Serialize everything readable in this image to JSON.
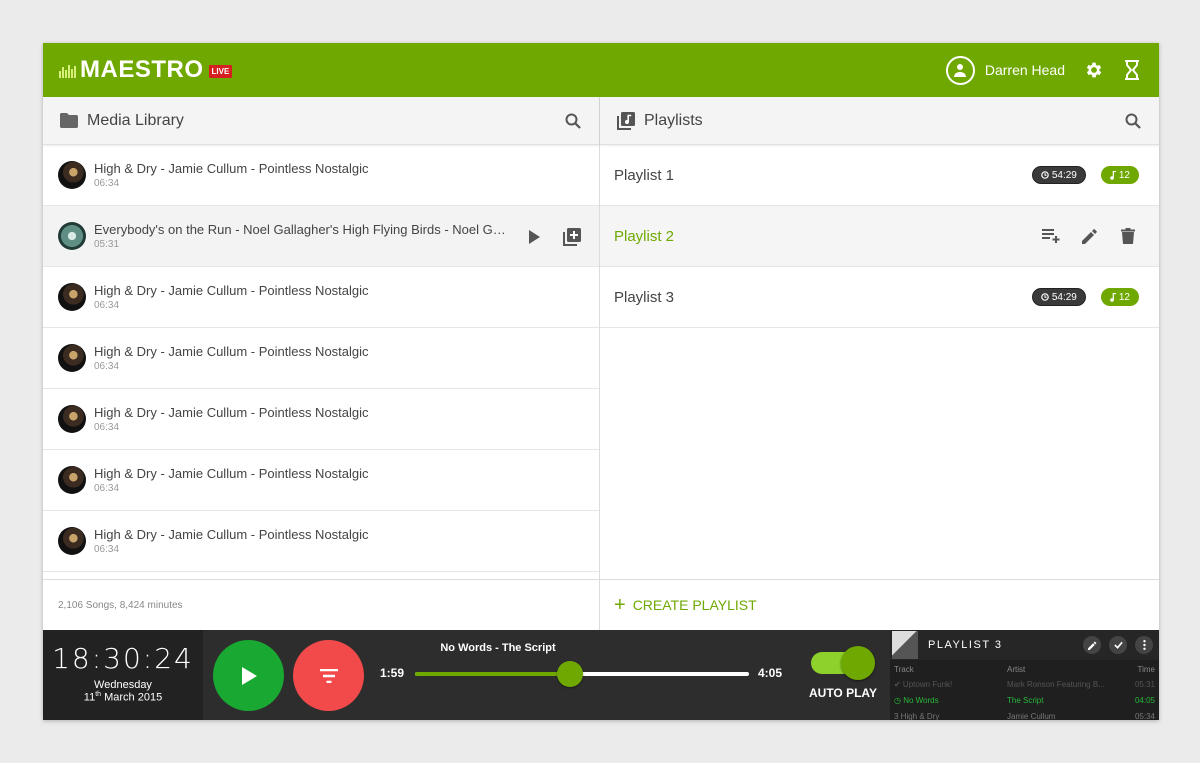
{
  "header": {
    "logo_text": "MAESTRO",
    "live_badge": "LIVE",
    "user_name": "Darren Head",
    "colors": {
      "brand_green": "#6fa800",
      "live_red": "#d61f1f"
    },
    "icons": [
      "account-circle-icon",
      "gear-icon",
      "hourglass-icon"
    ]
  },
  "library": {
    "title": "Media Library",
    "items": [
      {
        "title": "High & Dry - Jamie Cullum - Pointless Nostalgic",
        "duration": "06:34"
      },
      {
        "title": "Everybody's on the Run - Noel Gallagher's High Flying Birds - Noel Gallagher's High Flying Birds",
        "duration": "05:31"
      },
      {
        "title": "High & Dry - Jamie Cullum - Pointless Nostalgic",
        "duration": "06:34"
      },
      {
        "title": "High & Dry - Jamie Cullum - Pointless Nostalgic",
        "duration": "06:34"
      },
      {
        "title": "High & Dry - Jamie Cullum - Pointless Nostalgic",
        "duration": "06:34"
      },
      {
        "title": "High & Dry - Jamie Cullum - Pointless Nostalgic",
        "duration": "06:34"
      },
      {
        "title": "High & Dry - Jamie Cullum - Pointless Nostalgic",
        "duration": "06:34"
      }
    ],
    "footer": "2,106 Songs, 8,424 minutes"
  },
  "playlists": {
    "title": "Playlists",
    "items": [
      {
        "name": "Playlist 1",
        "time": "54:29",
        "count": "12"
      },
      {
        "name": "Playlist 2"
      },
      {
        "name": "Playlist 3",
        "time": "54:29",
        "count": "12"
      }
    ],
    "create_label": "CREATE PLAYLIST"
  },
  "player": {
    "clock_time": "18:30:24",
    "clock_day": "Wednesday",
    "clock_date_day": "11",
    "clock_date_suffix": "th",
    "clock_date_rest": " March 2015",
    "now_playing": "No Words - The Script",
    "current_time": "1:59",
    "total_time": "4:05",
    "progress": 0.465,
    "autoplay_label": "AUTO PLAY",
    "autoplay_on": true,
    "colors": {
      "play": "#19a832",
      "filter": "#f24a4a"
    }
  },
  "mini_playlist": {
    "title": "PLAYLIST 3",
    "columns": [
      "Track",
      "Artist",
      "Time"
    ],
    "rows": [
      {
        "track": "✔ Uptown Funk!",
        "artist": "Mark Ronson Featuring B...",
        "time": "05:31"
      },
      {
        "track": "No Words",
        "artist": "The Script",
        "time": "04:05"
      },
      {
        "track": "3 High & Dry",
        "artist": "Jamie Cullum",
        "time": "05:34"
      }
    ]
  }
}
